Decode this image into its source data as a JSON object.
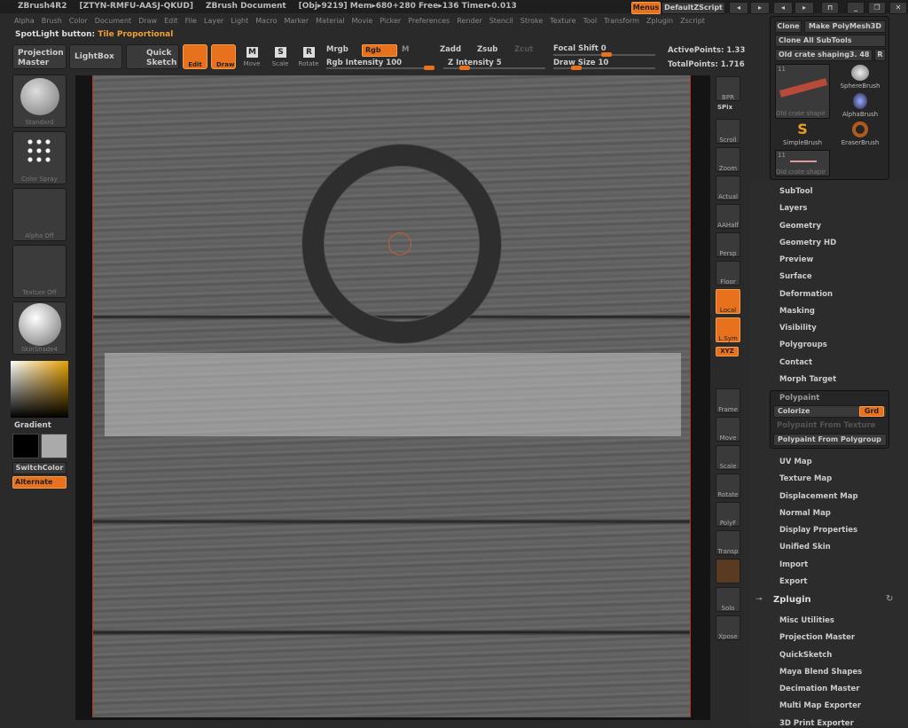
{
  "titlebar": {
    "app": "ZBrush4R2",
    "serial": "[ZTYN-RMFU-AASJ-QKUD]",
    "document": "ZBrush Document",
    "stats": "[Obj▸9219] Mem▸680+280 Free▸136 Timer▸0.013",
    "menus_button": "Menus",
    "script": "DefaultZScript"
  },
  "menubar": [
    "Alpha",
    "Brush",
    "Color",
    "Document",
    "Draw",
    "Edit",
    "File",
    "Layer",
    "Light",
    "Macro",
    "Marker",
    "Material",
    "Movie",
    "Picker",
    "Preferences",
    "Render",
    "Stencil",
    "Stroke",
    "Texture",
    "Tool",
    "Transform",
    "Zplugin",
    "Zscript"
  ],
  "spotlight": {
    "label": "SpotLight button:",
    "value": "Tile Proportional"
  },
  "toolbar": {
    "projection_master": "Projection Master",
    "lightbox": "LightBox",
    "quick_sketch": "Quick Sketch",
    "edit": "Edit",
    "draw": "Draw",
    "move": "Move",
    "scale": "Scale",
    "rotate": "Rotate",
    "move_key": "M",
    "scale_key": "S",
    "rotate_key": "R",
    "mrgb": "Mrgb",
    "rgb": "Rgb",
    "m": "M",
    "zadd": "Zadd",
    "zsub": "Zsub",
    "zcut": "Zcut",
    "rgb_intensity": "Rgb Intensity 100",
    "z_intensity": "Z Intensity 5",
    "focal_shift": "Focal Shift 0",
    "draw_size": "Draw Size 10",
    "active_points": "ActivePoints: 1.33",
    "total_points": "TotalPoints: 1.716",
    "rgb_intensity_value": 100,
    "z_intensity_value": 5,
    "focal_shift_value": 0,
    "draw_size_value": 10
  },
  "left": {
    "brush": "Standard",
    "stroke": "Color Spray",
    "alpha": "Alpha Off",
    "texture": "Texture Off",
    "material": "SkinShade4",
    "gradient": "Gradient",
    "switch_color": "SwitchColor",
    "alternate": "Alternate"
  },
  "right_toolbar": [
    "BPR",
    "SPix",
    "Scroll",
    "Zoom",
    "Actual",
    "AAHalf",
    "Persp",
    "Floor",
    "Local",
    "L.Sym",
    "XYZ",
    "Frame",
    "Move",
    "Scale",
    "Rotate",
    "PolyF",
    "Transp",
    "Solo",
    "Xpose"
  ],
  "tool_popup": {
    "clone": "Clone",
    "make_polymesh": "Make PolyMesh3D",
    "clone_all": "Clone All SubTools",
    "current_tool": "Old crate shaping3. 48",
    "r": "R",
    "thumb_count": "11",
    "thumb_label": "Old crate shapir",
    "brushes": [
      "SphereBrush",
      "AlphaBrush",
      "SimpleBrush",
      "EraserBrush"
    ],
    "thumb2_label": "Old crate shapir",
    "thumb2_count": "11"
  },
  "tool_menu": [
    "SubTool",
    "Layers",
    "Geometry",
    "Geometry HD",
    "Preview",
    "Surface",
    "Deformation",
    "Masking",
    "Visibility",
    "Polygroups",
    "Contact",
    "Morph Target"
  ],
  "polypaint": {
    "title": "Polypaint",
    "colorize": "Colorize",
    "grd": "Grd",
    "from_texture": "Polypaint From Texture",
    "from_polygroup": "Polypaint From Polygroup"
  },
  "tool_menu2": [
    "UV Map",
    "Texture Map",
    "Displacement Map",
    "Normal Map",
    "Display Properties",
    "Unified Skin",
    "Import",
    "Export"
  ],
  "zplugin": {
    "title": "Zplugin",
    "items": [
      "Misc Utilities",
      "Projection Master",
      "QuickSketch",
      "Maya Blend Shapes",
      "Decimation Master",
      "Multi Map Exporter",
      "3D Print Exporter"
    ]
  },
  "colors": {
    "accent": "#e8711e",
    "background": "#2a2a2a"
  }
}
